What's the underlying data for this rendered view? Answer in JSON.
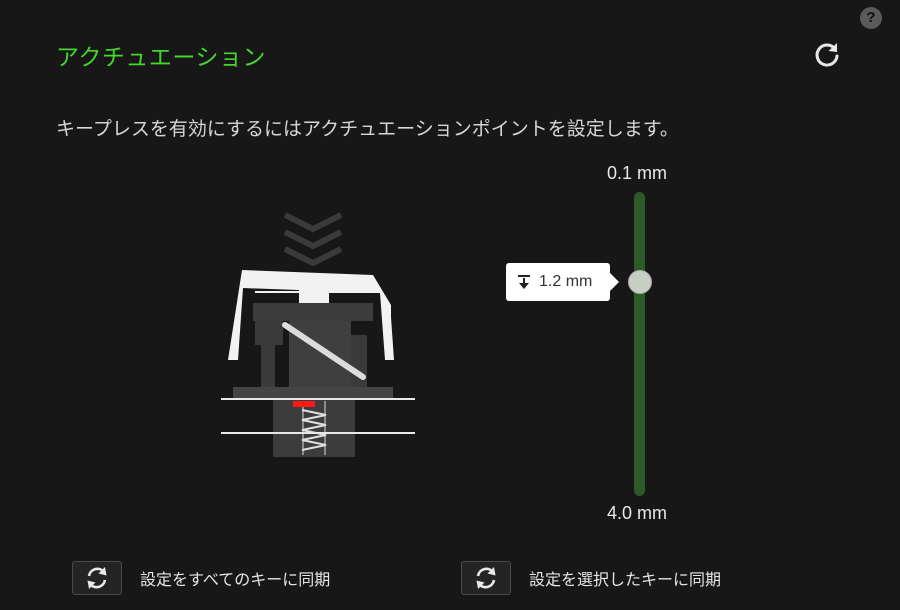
{
  "header": {
    "title": "アクチュエーション",
    "help_label": "?"
  },
  "description": "キープレスを有効にするにはアクチュエーションポイントを設定します。",
  "slider": {
    "min_label": "0.1 mm",
    "max_label": "4.0 mm",
    "value_label": "1.2 mm",
    "value_mm": 1.2,
    "min_mm": 0.1,
    "max_mm": 4.0
  },
  "buttons": {
    "sync_all": "設定をすべてのキーに同期",
    "sync_selected": "設定を選択したキーに同期"
  },
  "colors": {
    "accent": "#44d62c",
    "background": "#171717",
    "track": "#2d5a28",
    "actuation_marker": "#ff1a1a"
  },
  "icons": {
    "help": "question-icon",
    "reset": "refresh-icon",
    "value": "arrow-down-to-line-icon",
    "sync": "sync-icon"
  }
}
